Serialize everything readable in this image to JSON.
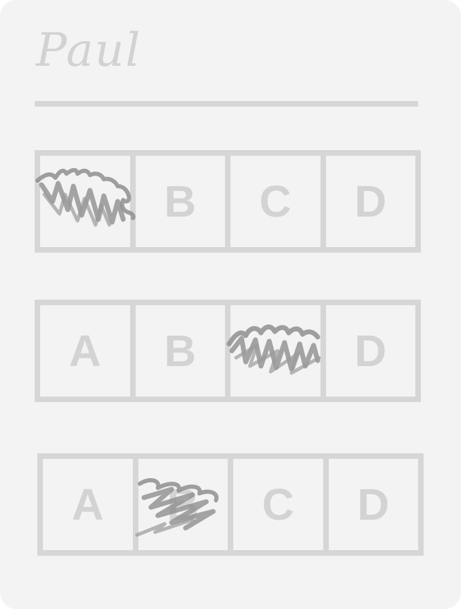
{
  "answer_sheet": {
    "student_name": "Paul",
    "questions": [
      {
        "options": [
          "A",
          "B",
          "C",
          "D"
        ],
        "selected": "A"
      },
      {
        "options": [
          "A",
          "B",
          "C",
          "D"
        ],
        "selected": "C"
      },
      {
        "options": [
          "A",
          "B",
          "C",
          "D"
        ],
        "selected": "B"
      }
    ]
  },
  "colors": {
    "card_background": "#f3f3f3",
    "grid_line": "#d6d6d6",
    "option_letter": "#d3d3d3",
    "pencil_mark": "#8e8e8e"
  }
}
